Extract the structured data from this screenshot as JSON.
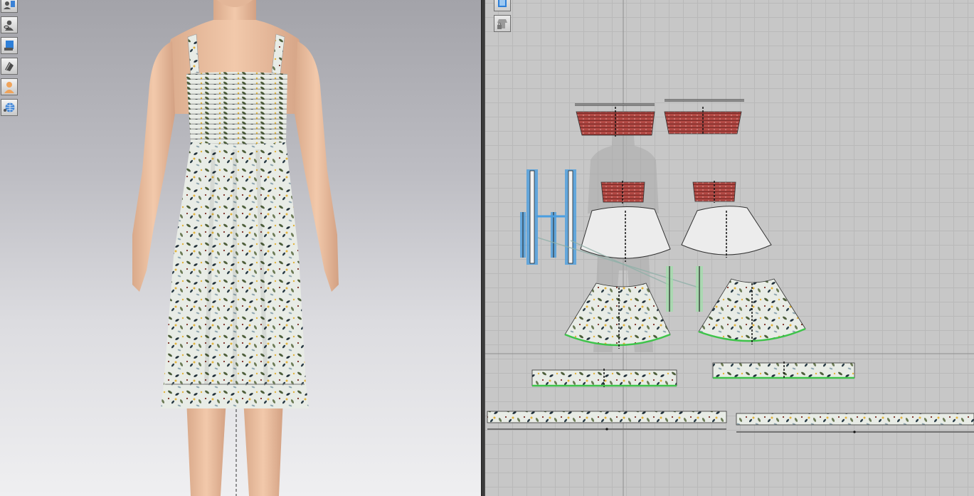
{
  "app": {
    "accent_color": "#4a9ee0",
    "grid_color": "#b9b9b9",
    "board_color": "#c7c7c7"
  },
  "view3d": {
    "toolbar": [
      {
        "icon": "avatar-visibility-icon"
      },
      {
        "icon": "avatar-silhouette-icon"
      },
      {
        "icon": "garment-display-icon"
      },
      {
        "icon": "texture-mode-icon"
      },
      {
        "icon": "avatar-skin-icon"
      },
      {
        "icon": "world-environment-icon"
      }
    ],
    "garment": {
      "fabric": "floral print",
      "style": "smocked midi sundress"
    }
  },
  "view2d": {
    "toolbar": [
      {
        "icon": "pattern-display-icon"
      },
      {
        "icon": "lock-garment-icon"
      }
    ],
    "pattern_pieces": [
      {
        "name": "bodice-front-smock"
      },
      {
        "name": "bodice-back-smock"
      },
      {
        "name": "bodice-lining-front"
      },
      {
        "name": "bodice-lining-back"
      },
      {
        "name": "skirt-yoke-front"
      },
      {
        "name": "skirt-yoke-back"
      },
      {
        "name": "skirt-front"
      },
      {
        "name": "skirt-back"
      },
      {
        "name": "ruffle-front"
      },
      {
        "name": "ruffle-back"
      },
      {
        "name": "hem-band-front"
      },
      {
        "name": "hem-band-back"
      },
      {
        "name": "strap-left"
      },
      {
        "name": "strap-right"
      }
    ]
  }
}
